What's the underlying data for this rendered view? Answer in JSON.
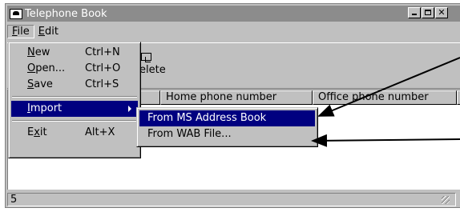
{
  "window": {
    "title": "Telephone Book",
    "caption_buttons": [
      "minimize",
      "maximize",
      "close"
    ]
  },
  "menubar": [
    {
      "label": "File",
      "mnemonic": "F",
      "rest": "ile"
    },
    {
      "label": "Edit",
      "mnemonic": "E",
      "rest": "dit"
    }
  ],
  "toolbar": {
    "delete_label": "Delete",
    "delete_icon": "delete-icon"
  },
  "list": {
    "columns": [
      "",
      "Home phone number",
      "Office phone number",
      ""
    ]
  },
  "status": {
    "count": "5"
  },
  "file_menu": {
    "items": [
      {
        "pre": "",
        "mn": "N",
        "post": "ew",
        "shortcut": "Ctrl+N"
      },
      {
        "pre": "",
        "mn": "O",
        "post": "pen...",
        "shortcut": "Ctrl+O"
      },
      {
        "pre": "",
        "mn": "S",
        "post": "ave",
        "shortcut": "Ctrl+S"
      },
      {
        "pre": "",
        "mn": "I",
        "post": "mport",
        "shortcut": ""
      },
      {
        "pre": "E",
        "mn": "x",
        "post": "it",
        "shortcut": "Alt+X"
      }
    ]
  },
  "import_submenu": {
    "items": [
      "From MS Address Book",
      "From WAB File..."
    ]
  },
  "colors": {
    "title_bg": "#8c8c8c",
    "highlight": "#000080",
    "face": "#c0c0c0"
  }
}
